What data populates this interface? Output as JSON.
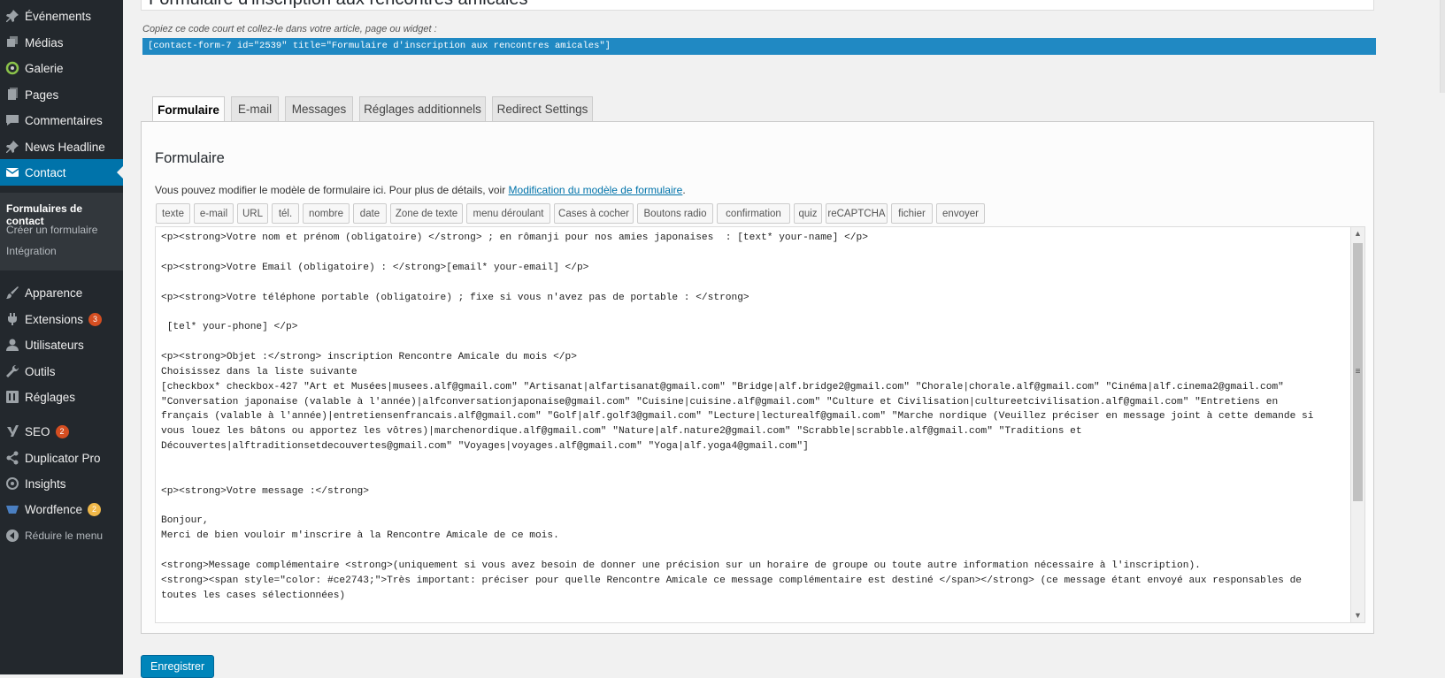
{
  "sidebar": {
    "items": [
      {
        "label": "Événements",
        "icon": "pin-icon"
      },
      {
        "label": "Médias",
        "icon": "media-icon"
      },
      {
        "label": "Galerie",
        "icon": "gallery-icon"
      },
      {
        "label": "Pages",
        "icon": "pages-icon"
      },
      {
        "label": "Commentaires",
        "icon": "comments-icon"
      },
      {
        "label": "News Headline",
        "icon": "pin-icon"
      },
      {
        "label": "Contact",
        "icon": "mail-icon"
      },
      {
        "label": "Apparence",
        "icon": "brush-icon"
      },
      {
        "label": "Extensions",
        "icon": "plugin-icon",
        "badge": "3"
      },
      {
        "label": "Utilisateurs",
        "icon": "user-icon"
      },
      {
        "label": "Outils",
        "icon": "wrench-icon"
      },
      {
        "label": "Réglages",
        "icon": "settings-icon"
      },
      {
        "label": "SEO",
        "icon": "yoast-icon",
        "badge": "2"
      },
      {
        "label": "Duplicator Pro",
        "icon": "share-icon"
      },
      {
        "label": "Insights",
        "icon": "insights-icon"
      },
      {
        "label": "Wordfence",
        "icon": "wordfence-icon",
        "badge": "2"
      },
      {
        "label": "Réduire le menu",
        "icon": "collapse-icon"
      }
    ],
    "submenu": [
      "Formulaires de contact",
      "Créer un formulaire",
      "Intégration"
    ],
    "badge_colors": {
      "extensions": "#d54e21",
      "seo": "#d54e21",
      "wordfence": "#f0b849"
    }
  },
  "form": {
    "title": "Formulaire d'inscription aux rencontres amicales",
    "shortcode_hint": "Copiez ce code court et collez-le dans votre article, page ou widget :",
    "shortcode": "[contact-form-7 id=\"2539\" title=\"Formulaire d'inscription aux rencontres amicales\"]"
  },
  "tabs": [
    "Formulaire",
    "E-mail",
    "Messages",
    "Réglages additionnels",
    "Redirect Settings"
  ],
  "panel": {
    "title": "Formulaire",
    "desc_prefix": "Vous pouvez modifier le modèle de formulaire ici. Pour plus de détails, voir ",
    "desc_link": "Modification du modèle de formulaire",
    "desc_suffix": "."
  },
  "tag_buttons": [
    "texte",
    "e-mail",
    "URL",
    "tél.",
    "nombre",
    "date",
    "Zone de texte",
    "menu déroulant",
    "Cases à cocher",
    "Boutons radio",
    "confirmation",
    "quiz",
    "reCAPTCHA",
    "fichier",
    "envoyer"
  ],
  "editor_lines": [
    "<p><strong>Votre nom et prénom (obligatoire) </strong> ; en rômanji pour nos amies japonaises  : [text* your-name] </p>",
    "<p><strong>Votre Email (obligatoire) : </strong>[email* your-email] </p>",
    "<p><strong>Votre téléphone portable (obligatoire) ; fixe si vous n'avez pas de portable : </strong>",
    " [tel* your-phone] </p>",
    "<p><strong>Objet :</strong> inscription Rencontre Amicale du mois </p>",
    "Choisissez dans la liste suivante",
    "[checkbox* checkbox-427 \"Art et Musées|musees.alf@gmail.com\" \"Artisanat|alfartisanat@gmail.com\" \"Bridge|alf.bridge2@gmail.com\" \"Chorale|chorale.alf@gmail.com\" \"Cinéma|alf.cinema2@gmail.com\"",
    "\"Conversation japonaise (valable à l'année)|alfconversationjaponaise@gmail.com\" \"Cuisine|cuisine.alf@gmail.com\" \"Culture et Civilisation|cultureetcivilisation.alf@gmail.com\" \"Entretiens en",
    "français (valable à l'année)|entretiensenfrancais.alf@gmail.com\" \"Golf|alf.golf3@gmail.com\" \"Lecture|lecturealf@gmail.com\" \"Marche nordique (Veuillez préciser en message joint à cette demande si",
    "vous louez les bâtons ou apportez les vôtres)|marchenordique.alf@gmail.com\" \"Nature|alf.nature2@gmail.com\" \"Scrabble|scrabble.alf@gmail.com\" \"Traditions et",
    "Découvertes|alftraditionsetdecouvertes@gmail.com\" \"Voyages|voyages.alf@gmail.com\" \"Yoga|alf.yoga4@gmail.com\"]",
    "<p><strong>Votre message :</strong>",
    "Bonjour,",
    "Merci de bien vouloir m'inscrire à la Rencontre Amicale de ce mois.",
    "<strong>Message complémentaire <strong>(uniquement si vous avez besoin de donner une précision sur un horaire de groupe ou toute autre information nécessaire à l'inscription).",
    "<strong><span style=\"color: #ce2743;\">Très important: préciser pour quelle Rencontre Amicale ce message complémentaire est destiné </span></strong> (ce message étant envoyé aux responsables de",
    "toutes les cases sélectionnées)"
  ],
  "save_label": "Enregistrer",
  "colors": {
    "accent": "#0073aa",
    "sidebar_bg": "#23282d",
    "shortcode_bg": "#2089c3",
    "save_button": "#0085ba"
  }
}
